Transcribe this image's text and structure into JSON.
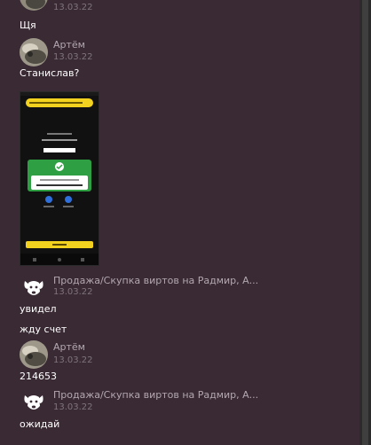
{
  "messages": {
    "top_time": "13.03.22",
    "msg1": "Щя",
    "author1": "Артём",
    "time1": "13.03.22",
    "msg2": "Станислав?",
    "screenshot": {
      "banner": "Перевод через СБП (ПИН Уфимский банк)",
      "amount": "− 500 ₽",
      "status": "Успешно",
      "confirm": "Отправлено",
      "bottom_button": "Готово"
    },
    "author2": "Продажа/Скупка виртов на Радмир, А...",
    "time2": "13.03.22",
    "msg3": "увидел",
    "msg4": "жду счет",
    "author3": "Артём",
    "time3": "13.03.22",
    "msg5": "214653",
    "author4": "Продажа/Скупка виртов на Радмир, А...",
    "time4": "13.03.22",
    "msg6": "ожидай"
  },
  "colors": {
    "background": "#3a2a34",
    "name": "#b3a7b0",
    "timestamp": "#7f747c",
    "success_green": "#2ea043",
    "button_yellow": "#f3d21f"
  },
  "icons": [
    "cat-avatar-icon",
    "dog-avatar-icon"
  ]
}
